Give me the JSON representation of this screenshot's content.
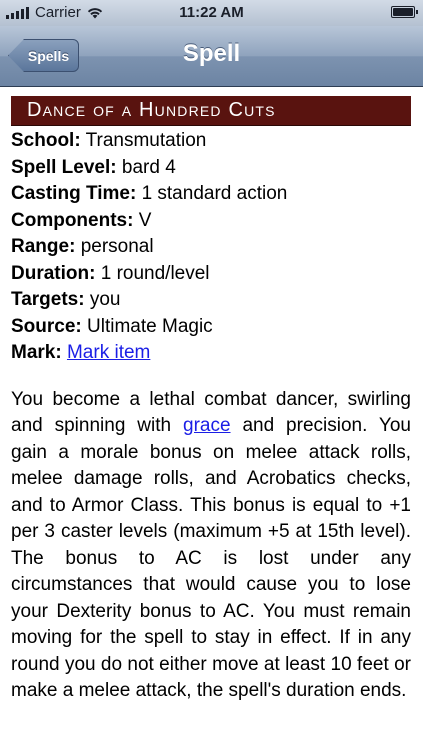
{
  "status_bar": {
    "carrier": "Carrier",
    "time": "11:22 AM",
    "icons": [
      "signal-icon",
      "wifi-icon",
      "battery-icon"
    ]
  },
  "nav": {
    "back_label": "Spells",
    "title": "Spell"
  },
  "spell": {
    "name": "Dance of a Hundred Cuts",
    "fields": [
      {
        "label": "School:",
        "value": "Transmutation"
      },
      {
        "label": "Spell Level:",
        "value": "bard 4"
      },
      {
        "label": "Casting Time:",
        "value": "1 standard action"
      },
      {
        "label": "Components:",
        "value": "V"
      },
      {
        "label": "Range:",
        "value": "personal"
      },
      {
        "label": "Duration:",
        "value": "1 round/level"
      },
      {
        "label": "Targets:",
        "value": "you"
      },
      {
        "label": "Source:",
        "value": "Ultimate Magic"
      }
    ],
    "mark": {
      "label": "Mark:",
      "link": "Mark item"
    },
    "description": {
      "before_link": "You become a lethal combat dancer, swirling and spinning with ",
      "link": "grace",
      "after_link": " and precision. You gain a morale bonus on melee attack rolls, melee damage rolls, and Acrobatics checks, and to Armor Class. This bonus is equal to +1 per 3 caster levels (maximum +5 at 15th level). The bonus to AC is lost under any circumstances that would cause you to lose your Dexterity bonus to AC. You must remain moving for the spell to stay in effect. If in any round you do not either move at least 10 feet or make a melee attack, the spell's duration ends."
    }
  },
  "colors": {
    "title_bar": "#59130f",
    "link": "#1a1ee6"
  }
}
